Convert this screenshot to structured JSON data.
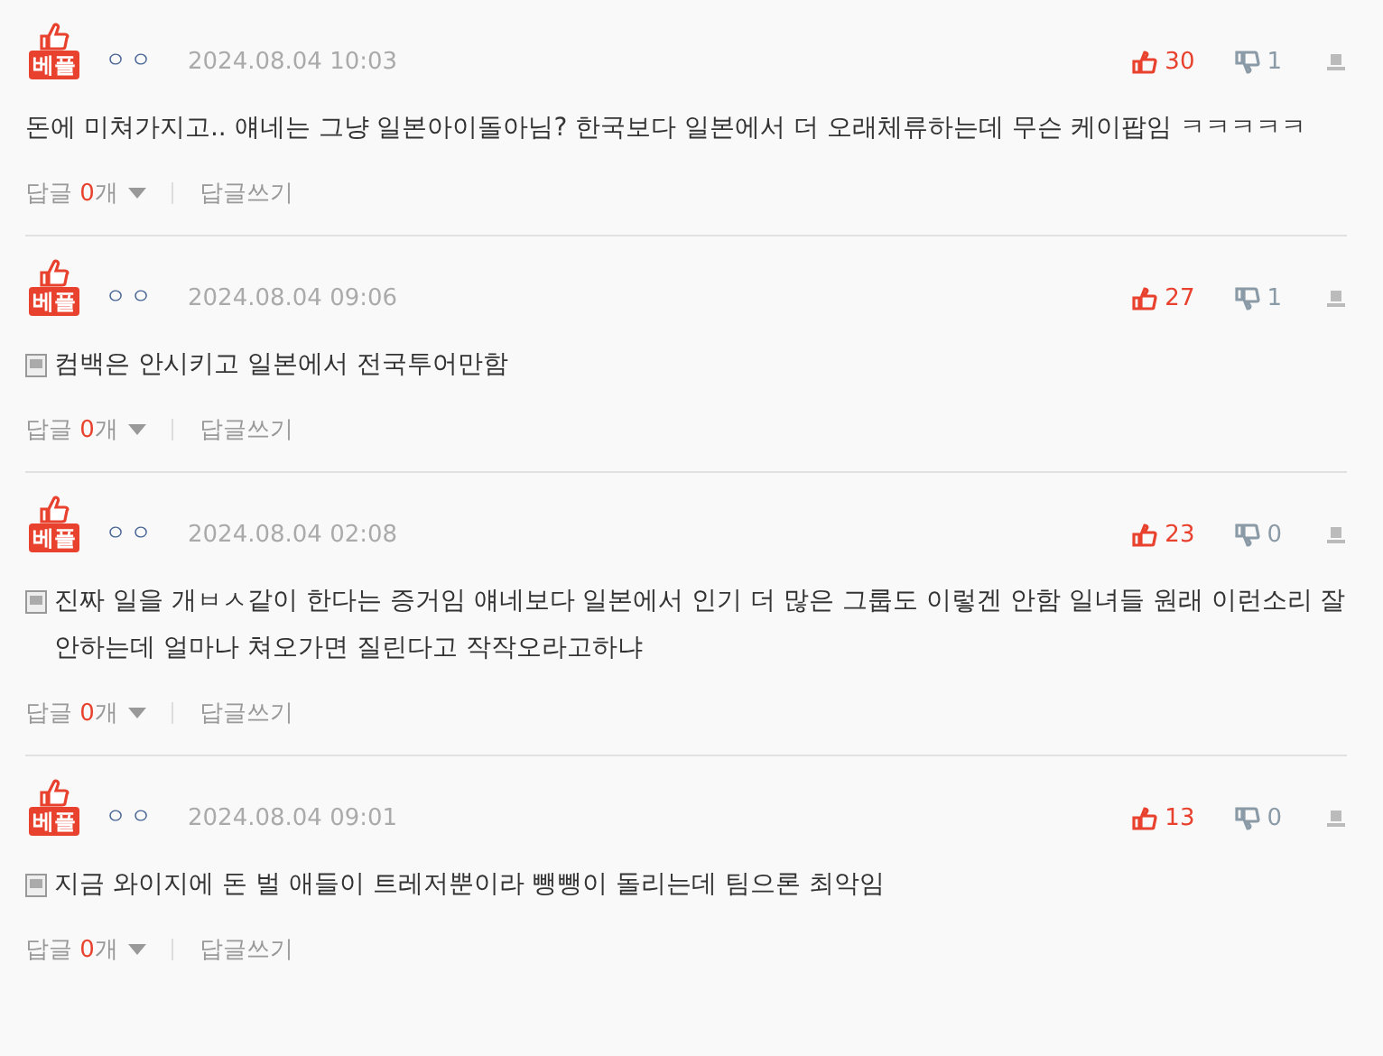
{
  "comments": [
    {
      "badge": "베플",
      "author": "ㅇㅇ",
      "date": "2024.08.04 10:03",
      "likes": "30",
      "dislikes": "1",
      "kind": "plain",
      "text": "돈에 미쳐가지고.. 얘네는 그냥 일본아이돌아님? 한국보다 일본에서 더 오래체류하는데 무슨 케이팝임 ㅋㅋㅋㅋㅋ",
      "reply_label": "답글",
      "reply_count": "0",
      "reply_unit": "개",
      "write_reply": "답글쓰기"
    },
    {
      "badge": "베플",
      "author": "ㅇㅇ",
      "date": "2024.08.04 09:06",
      "likes": "27",
      "dislikes": "1",
      "kind": "note",
      "text": "컴백은 안시키고 일본에서 전국투어만함",
      "reply_label": "답글",
      "reply_count": "0",
      "reply_unit": "개",
      "write_reply": "답글쓰기"
    },
    {
      "badge": "베플",
      "author": "ㅇㅇ",
      "date": "2024.08.04 02:08",
      "likes": "23",
      "dislikes": "0",
      "kind": "note",
      "text": "진짜 일을 개ㅂㅅ같이 한다는 증거임 얘네보다 일본에서 인기 더 많은 그룹도 이렇겐 안함 일녀들 원래 이런소리 잘 안하는데 얼마나 쳐오가면 질린다고 작작오라고하냐",
      "reply_label": "답글",
      "reply_count": "0",
      "reply_unit": "개",
      "write_reply": "답글쓰기"
    },
    {
      "badge": "베플",
      "author": "ㅇㅇ",
      "date": "2024.08.04 09:01",
      "likes": "13",
      "dislikes": "0",
      "kind": "note",
      "text": "지금 와이지에 돈 벌 애들이 트레저뿐이라 뺑뺑이 돌리는데 팀으론 최악임",
      "reply_label": "답글",
      "reply_count": "0",
      "reply_unit": "개",
      "write_reply": "답글쓰기"
    }
  ]
}
